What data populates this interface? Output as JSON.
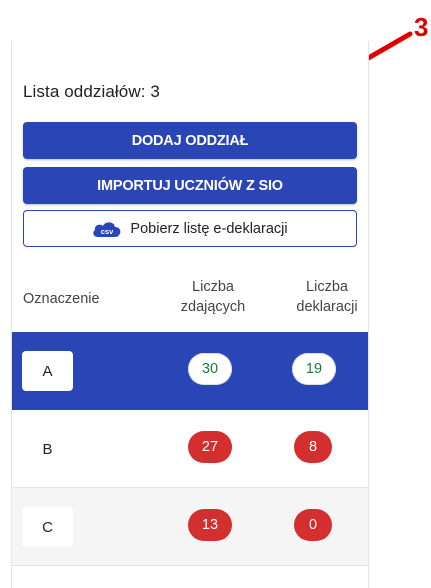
{
  "annotation": {
    "number": "3",
    "color": "#e00000"
  },
  "panel": {
    "title_prefix": "Lista oddziałów:",
    "title_count": "3",
    "buttons": {
      "add_unit": "DODAJ ODDZIAŁ",
      "import_students": "IMPORTUJ UCZNIÓW Z SIO",
      "download_list": "Pobierz listę e-deklaracji",
      "csv_badge": "csv"
    },
    "table": {
      "headers": {
        "designation": "Oznaczenie",
        "count_takers_line1": "Liczba",
        "count_takers_line2": "zdających",
        "count_decl_line1": "Liczba",
        "count_decl_line2": "deklaracji"
      },
      "rows": [
        {
          "label": "A",
          "takers": "30",
          "declarations": "19",
          "status": "ok",
          "selected": true
        },
        {
          "label": "B",
          "takers": "27",
          "declarations": "8",
          "status": "bad",
          "selected": false
        },
        {
          "label": "C",
          "takers": "13",
          "declarations": "0",
          "status": "bad",
          "selected": false
        }
      ]
    },
    "colors": {
      "primary": "#2945b6",
      "ok_text": "#1f7a3a",
      "bad_badge": "#d32f2f"
    }
  }
}
